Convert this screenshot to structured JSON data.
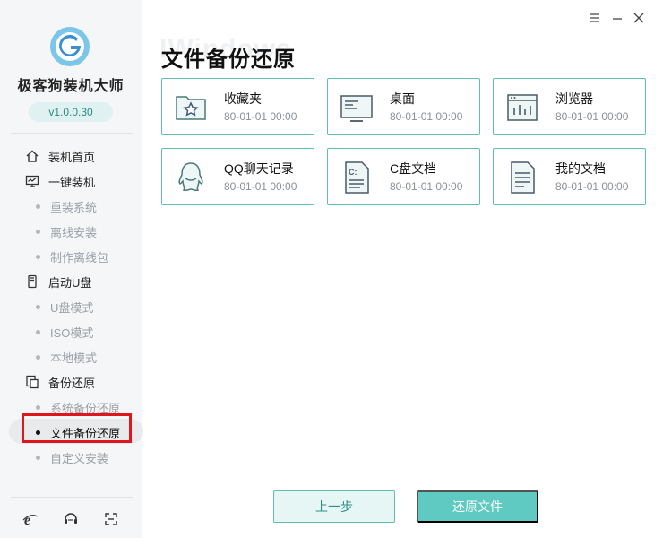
{
  "app": {
    "name": "极客狗装机大师",
    "version": "v1.0.0.30"
  },
  "window_controls": [
    "menu-icon",
    "minimize-icon",
    "close-icon"
  ],
  "nav": {
    "home": "装机首页",
    "one_click": "一键装机",
    "reinstall": "重装系统",
    "offline_install": "离线安装",
    "make_offline": "制作离线包",
    "usb_boot": "启动U盘",
    "usb_mode": "U盘模式",
    "iso_mode": "ISO模式",
    "local_mode": "本地模式",
    "backup_restore": "备份还原",
    "system_backup": "系统备份还原",
    "file_backup": "文件备份还原",
    "custom_install": "自定义安装"
  },
  "bottom_icons": [
    "ie-icon",
    "chat-icon",
    "fullscreen-icon"
  ],
  "main": {
    "title": "文件备份还原",
    "watermark": "IWindows",
    "cards": [
      {
        "name": "收藏夹",
        "date": "80-01-01 00:00",
        "icon": "favorites-folder-icon"
      },
      {
        "name": "桌面",
        "date": "80-01-01 00:00",
        "icon": "desktop-icon"
      },
      {
        "name": "浏览器",
        "date": "80-01-01 00:00",
        "icon": "browser-icon"
      },
      {
        "name": "QQ聊天记录",
        "date": "80-01-01 00:00",
        "icon": "qq-icon"
      },
      {
        "name": "C盘文档",
        "date": "80-01-01 00:00",
        "icon": "c-drive-doc-icon"
      },
      {
        "name": "我的文档",
        "date": "80-01-01 00:00",
        "icon": "document-icon"
      }
    ],
    "prev_button": "上一步",
    "restore_button": "还原文件"
  },
  "colors": {
    "accent": "#5ecac1",
    "card_border": "#5fbdb6",
    "highlight": "#e0161f"
  }
}
